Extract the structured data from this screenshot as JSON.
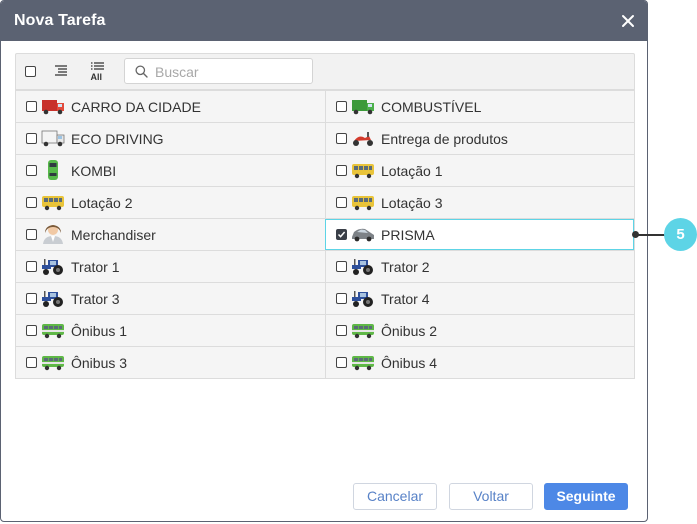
{
  "dialog": {
    "title": "Nova Tarefa"
  },
  "toolbar": {
    "search_placeholder": "Buscar",
    "all_label": "All"
  },
  "units": [
    [
      {
        "label": "CARRO DA CIDADE",
        "icon": "truck-red-icon",
        "checked": false
      },
      {
        "label": "COMBUSTÍVEL",
        "icon": "truck-green-icon",
        "checked": false
      }
    ],
    [
      {
        "label": "ECO DRIVING",
        "icon": "truck-white-icon",
        "checked": false
      },
      {
        "label": "Entrega de produtos",
        "icon": "scooter-icon",
        "checked": false
      }
    ],
    [
      {
        "label": "KOMBI",
        "icon": "car-topview-icon",
        "checked": false
      },
      {
        "label": "Lotação 1",
        "icon": "bus-yellow-icon",
        "checked": false
      }
    ],
    [
      {
        "label": "Lotação 2",
        "icon": "bus-yellow-icon",
        "checked": false
      },
      {
        "label": "Lotação 3",
        "icon": "bus-yellow-icon",
        "checked": false
      }
    ],
    [
      {
        "label": "Merchandiser",
        "icon": "person-icon",
        "checked": false
      },
      {
        "label": "PRISMA",
        "icon": "car-gray-icon",
        "checked": true
      }
    ],
    [
      {
        "label": "Trator 1",
        "icon": "tractor-icon",
        "checked": false
      },
      {
        "label": "Trator 2",
        "icon": "tractor-icon",
        "checked": false
      }
    ],
    [
      {
        "label": "Trator 3",
        "icon": "tractor-icon",
        "checked": false
      },
      {
        "label": "Trator 4",
        "icon": "tractor-icon",
        "checked": false
      }
    ],
    [
      {
        "label": "Ônibus 1",
        "icon": "bus-green-icon",
        "checked": false
      },
      {
        "label": "Ônibus 2",
        "icon": "bus-green-icon",
        "checked": false
      }
    ],
    [
      {
        "label": "Ônibus 3",
        "icon": "bus-green-icon",
        "checked": false
      },
      {
        "label": "Ônibus 4",
        "icon": "bus-green-icon",
        "checked": false
      }
    ]
  ],
  "callout": {
    "number": "5"
  },
  "buttons": {
    "cancel": "Cancelar",
    "back": "Voltar",
    "next": "Seguinte"
  },
  "colors": {
    "titlebar": "#5b6272",
    "accent": "#4d88e6",
    "highlight": "#5dd4e6"
  }
}
